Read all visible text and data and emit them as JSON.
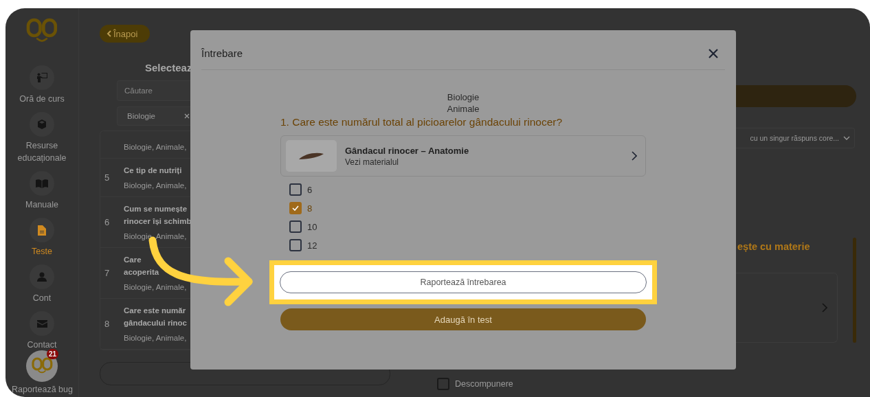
{
  "sidebar": {
    "items": [
      {
        "kind": "teacher",
        "label": "Oră de curs",
        "selected": false
      },
      {
        "kind": "cube",
        "label": "Resurse educaționale",
        "selected": false
      },
      {
        "kind": "book",
        "label": "Manuale",
        "selected": false
      },
      {
        "kind": "document",
        "label": "Teste",
        "selected": true
      },
      {
        "kind": "person",
        "label": "Cont",
        "selected": false
      },
      {
        "kind": "envelope",
        "label": "Contact",
        "selected": false
      }
    ],
    "badge": "21",
    "bug_label": "Raportează bug"
  },
  "background": {
    "back_button": "Înapoi",
    "heading": "Selecteaz",
    "search_placeholder": "Căutare",
    "filter_chip": "Biologie",
    "questions": [
      {
        "tags": "Biologie, Animale,"
      },
      {
        "number": "5",
        "lines": [
          "Ce tip de nutriți"
        ],
        "tags": "Biologie, Animale,"
      },
      {
        "number": "6",
        "lines": [
          "Cum se numește",
          "rinocer își schimb"
        ],
        "tags": "Biologie, Animale,"
      },
      {
        "number": "7",
        "lines": [
          "Care",
          "acoperita"
        ],
        "tags": "Biologie, Animale,"
      },
      {
        "number": "8",
        "lines": [
          "Care este număr",
          "gândacului rinoc"
        ],
        "tags": "Biologie, Animale,"
      }
    ],
    "type_select": "cu un singur răspuns core...",
    "section_heading": "ește cu materie",
    "decomposition": {
      "label": "Descompunere",
      "checked": false
    }
  },
  "modal": {
    "title": "Întrebare",
    "subject": "Biologie",
    "topic": "Animale",
    "question": "1. Care este numărul total al picioarelor gândacului rinocer?",
    "material": {
      "title": "Gândacul rinocer – Anatomie",
      "link": "Vezi materialul"
    },
    "options": [
      {
        "label": "6",
        "checked": false
      },
      {
        "label": "8",
        "checked": true
      },
      {
        "label": "10",
        "checked": false
      },
      {
        "label": "12",
        "checked": false
      }
    ],
    "report_button": "Raportează întrebarea",
    "add_button": "Adaugă în test"
  }
}
